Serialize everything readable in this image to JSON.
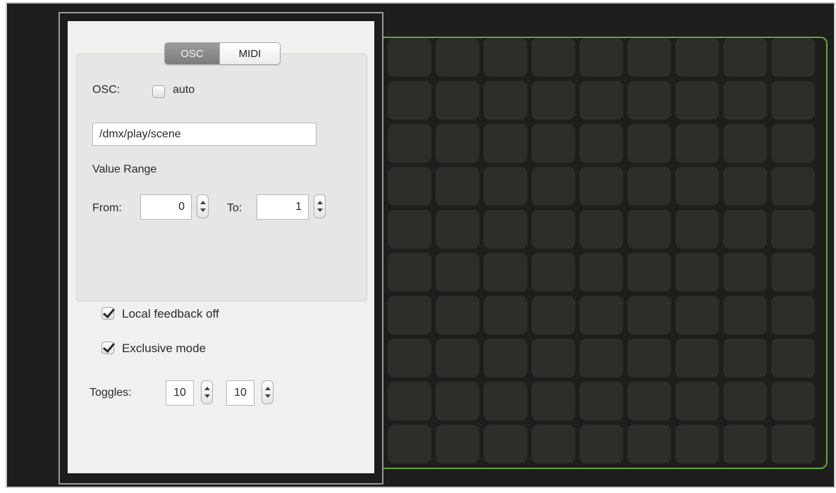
{
  "tabs": {
    "osc_label": "OSC",
    "midi_label": "MIDI",
    "active": "OSC"
  },
  "osc": {
    "label": "OSC:",
    "auto_label": "auto",
    "auto_checked": false,
    "address": "/dmx/play/scene"
  },
  "value_range": {
    "heading": "Value Range",
    "from_label": "From:",
    "from_value": "0",
    "to_label": "To:",
    "to_value": "1"
  },
  "options": {
    "local_feedback_label": "Local feedback off",
    "local_feedback_checked": true,
    "exclusive_label": "Exclusive mode",
    "exclusive_checked": true
  },
  "toggles": {
    "label": "Toggles:",
    "columns": "10",
    "rows": "10"
  },
  "colors": {
    "grid_outline": "#62a63a",
    "cell": "#2c2e29",
    "background": "#1e1e1c",
    "panel": "#f2f0ee"
  }
}
